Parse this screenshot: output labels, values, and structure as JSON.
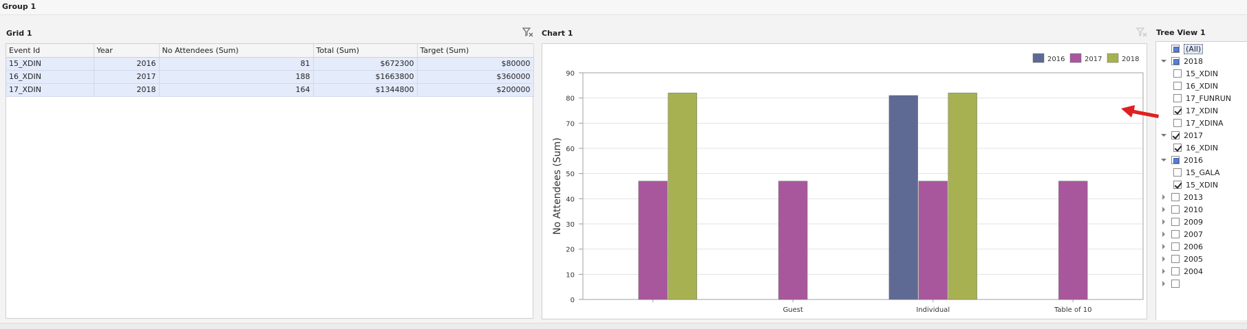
{
  "group": {
    "title": "Group 1"
  },
  "grid": {
    "title": "Grid 1",
    "columns": [
      "Event Id",
      "Year",
      "No Attendees (Sum)",
      "Total (Sum)",
      "Target (Sum)"
    ],
    "rows": [
      [
        "15_XDIN",
        "2016",
        "81",
        "$672300",
        "$80000"
      ],
      [
        "16_XDIN",
        "2017",
        "188",
        "$1663800",
        "$360000"
      ],
      [
        "17_XDIN",
        "2018",
        "164",
        "$1344800",
        "$200000"
      ]
    ]
  },
  "chart": {
    "title": "Chart 1"
  },
  "chart_data": {
    "type": "bar",
    "categories": [
      "",
      "Guest",
      "Individual",
      "Table of 10"
    ],
    "series": [
      {
        "name": "2016",
        "color": "#5f6a94",
        "values": [
          null,
          null,
          81,
          null
        ]
      },
      {
        "name": "2017",
        "color": "#a9579d",
        "values": [
          47,
          47,
          47,
          47
        ]
      },
      {
        "name": "2018",
        "color": "#a7b152",
        "values": [
          82,
          null,
          82,
          null
        ]
      }
    ],
    "ylabel": "No Attendees (Sum)",
    "ylim": [
      0,
      90
    ],
    "yticks": [
      "0",
      "10",
      "20",
      "30",
      "40",
      "50",
      "60",
      "70",
      "80",
      "90"
    ],
    "grid": true,
    "legend_position": "top-right"
  },
  "tree": {
    "title": "Tree View 1",
    "items": [
      {
        "label": "(All)",
        "level": 0,
        "state": "partial",
        "expander": "none",
        "selected": true
      },
      {
        "label": "2018",
        "level": 0,
        "state": "partial",
        "expander": "open"
      },
      {
        "label": "15_XDIN",
        "level": 1,
        "state": "unchecked",
        "expander": "none"
      },
      {
        "label": "16_XDIN",
        "level": 1,
        "state": "unchecked",
        "expander": "none"
      },
      {
        "label": "17_FUNRUN",
        "level": 1,
        "state": "unchecked",
        "expander": "none"
      },
      {
        "label": "17_XDIN",
        "level": 1,
        "state": "checked",
        "expander": "none"
      },
      {
        "label": "17_XDINA",
        "level": 1,
        "state": "unchecked",
        "expander": "none"
      },
      {
        "label": "2017",
        "level": 0,
        "state": "checked",
        "expander": "open"
      },
      {
        "label": "16_XDIN",
        "level": 1,
        "state": "checked",
        "expander": "none"
      },
      {
        "label": "2016",
        "level": 0,
        "state": "partial",
        "expander": "open"
      },
      {
        "label": "15_GALA",
        "level": 1,
        "state": "unchecked",
        "expander": "none"
      },
      {
        "label": "15_XDIN",
        "level": 1,
        "state": "checked",
        "expander": "none"
      },
      {
        "label": "2013",
        "level": 0,
        "state": "unchecked",
        "expander": "closed"
      },
      {
        "label": "2010",
        "level": 0,
        "state": "unchecked",
        "expander": "closed"
      },
      {
        "label": "2009",
        "level": 0,
        "state": "unchecked",
        "expander": "closed"
      },
      {
        "label": "2007",
        "level": 0,
        "state": "unchecked",
        "expander": "closed"
      },
      {
        "label": "2006",
        "level": 0,
        "state": "unchecked",
        "expander": "closed"
      },
      {
        "label": "2005",
        "level": 0,
        "state": "unchecked",
        "expander": "closed"
      },
      {
        "label": "2004",
        "level": 0,
        "state": "unchecked",
        "expander": "closed"
      },
      {
        "label": "",
        "level": 0,
        "state": "unchecked",
        "expander": "closed"
      }
    ]
  },
  "icons": {
    "grid_filter": "clear-filter-icon",
    "chart_filter": "clear-filter-icon",
    "arrow": "red-arrow-icon"
  },
  "colors": {
    "arrow": "#e02020",
    "selection": "#e4ebfb"
  }
}
